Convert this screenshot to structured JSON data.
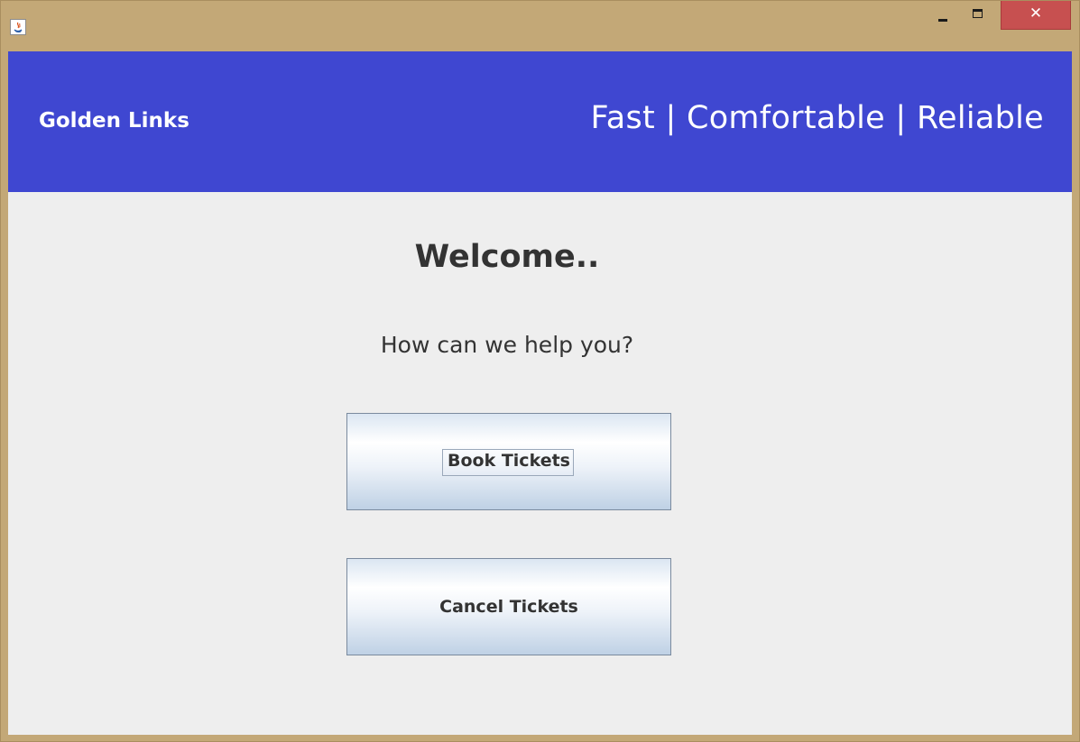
{
  "window": {
    "app_icon": "java-icon",
    "controls": {
      "minimize_icon": "minimize-icon",
      "maximize_icon": "maximize-icon",
      "close_label": "✕",
      "close_color": "#c75050"
    }
  },
  "banner": {
    "brand": "Golden Links",
    "tagline": "Fast | Comfortable | Reliable",
    "color": "#3f47d1"
  },
  "main": {
    "welcome": "Welcome..",
    "prompt": "How can we help you?",
    "book_label": "Book Tickets",
    "cancel_label": "Cancel Tickets"
  }
}
